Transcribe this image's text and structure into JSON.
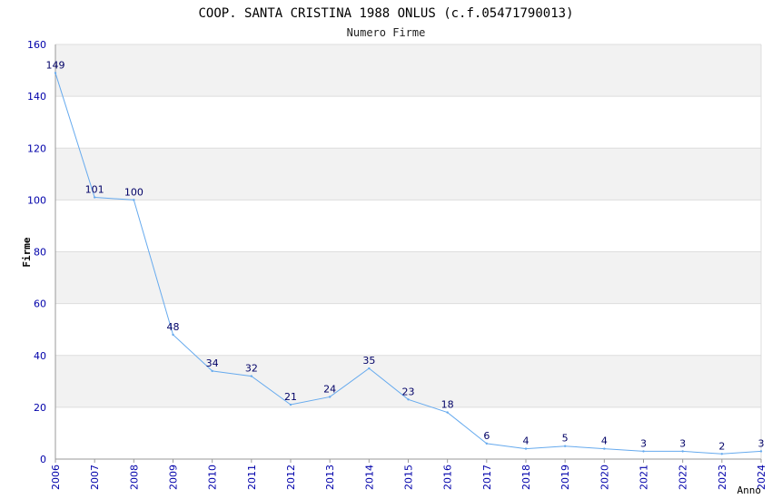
{
  "colors": {
    "line": "#66aaee",
    "band": "#f2f2f2",
    "grid": "#dddddd",
    "axis": "#999999",
    "tick_text": "#0000aa",
    "data_label_text": "#000066"
  },
  "chart_data": {
    "type": "line",
    "title": "COOP. SANTA CRISTINA 1988 ONLUS (c.f.05471790013)",
    "subtitle": "Numero Firme",
    "xlabel": "Anno",
    "ylabel": "Firme",
    "ylim": [
      0,
      160
    ],
    "yticks": [
      0,
      20,
      40,
      60,
      80,
      100,
      120,
      140,
      160
    ],
    "grid": true,
    "legend": "none",
    "x": [
      "2006",
      "2007",
      "2008",
      "2009",
      "2010",
      "2011",
      "2012",
      "2013",
      "2014",
      "2015",
      "2016",
      "2017",
      "2018",
      "2019",
      "2020",
      "2021",
      "2022",
      "2023",
      "2024"
    ],
    "values": [
      149,
      101,
      100,
      48,
      34,
      32,
      21,
      24,
      35,
      23,
      18,
      6,
      4,
      5,
      4,
      3,
      3,
      2,
      3
    ]
  }
}
